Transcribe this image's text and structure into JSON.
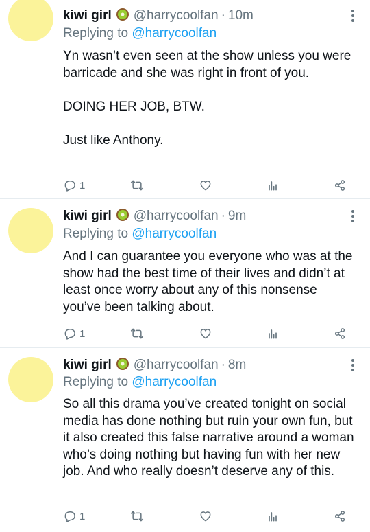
{
  "tweets": [
    {
      "name": "kiwi girl",
      "handle": "@harrycoolfan",
      "time": "10m",
      "reply_prefix": "Replying to",
      "reply_to": "@harrycoolfan",
      "text": "Yn wasn’t even seen at the show unless you were barricade and she was right in front of you.\n\nDOING HER JOB, BTW.\n\nJust like Anthony.",
      "reply_count": "1"
    },
    {
      "name": "kiwi girl",
      "handle": "@harrycoolfan",
      "time": "9m",
      "reply_prefix": "Replying to",
      "reply_to": "@harrycoolfan",
      "text": "And I can guarantee you everyone who was at the show had the best time of their lives and didn’t at least once worry about any of this nonsense you’ve been talking about.",
      "reply_count": "1"
    },
    {
      "name": "kiwi girl",
      "handle": "@harrycoolfan",
      "time": "8m",
      "reply_prefix": "Replying to",
      "reply_to": "@harrycoolfan",
      "text": "So all this drama you’ve created tonight on social media has done nothing but ruin your own fun, but it also created this false narrative around a woman who’s doing nothing but having fun with her new job. And who really doesn’t deserve any of this.",
      "reply_count": "1"
    }
  ],
  "separator": "·",
  "icons": {
    "badge": "kiwi-emoji-icon",
    "more": "more-vertical-icon",
    "reply": "reply-icon",
    "retweet": "retweet-icon",
    "like": "heart-icon",
    "analytics": "analytics-icon",
    "share": "share-icon"
  },
  "colors": {
    "avatar": "#fbf39a",
    "link": "#1da1f2",
    "secondary_text": "#66757f",
    "divider": "#e6ecf0"
  }
}
